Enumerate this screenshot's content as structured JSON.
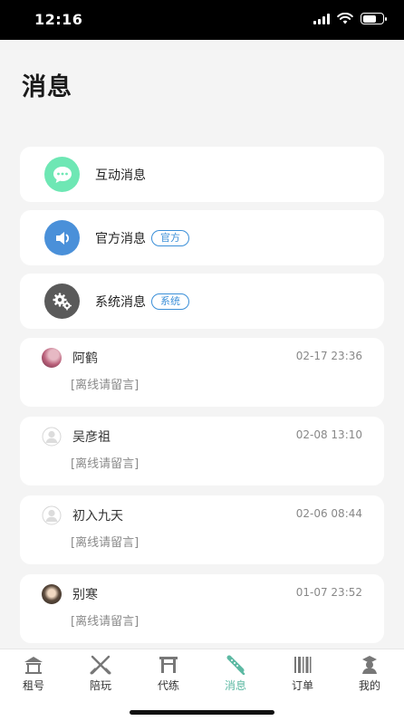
{
  "status": {
    "time": "12:16"
  },
  "page": {
    "title": "消息"
  },
  "categories": [
    {
      "label": "互动消息",
      "tag": "",
      "icon": "chat-bubble-icon",
      "color": "#6ee7b4"
    },
    {
      "label": "官方消息",
      "tag": "官方",
      "icon": "speaker-icon",
      "color": "#4a90d9"
    },
    {
      "label": "系统消息",
      "tag": "系统",
      "icon": "gear-icon",
      "color": "#5a5a5a"
    }
  ],
  "chats": [
    {
      "name": "阿鹤",
      "time": "02-17 23:36",
      "message": "[离线请留言]",
      "avatar": "photo"
    },
    {
      "name": "吴彦祖",
      "time": "02-08 13:10",
      "message": "[离线请留言]",
      "avatar": "default"
    },
    {
      "name": "初入九天",
      "time": "02-06 08:44",
      "message": "[离线请留言]",
      "avatar": "default"
    },
    {
      "name": "别寒",
      "time": "01-07 23:52",
      "message": "[离线请留言]",
      "avatar": "photo"
    }
  ],
  "tabs": [
    {
      "label": "租号",
      "icon": "pavilion-icon",
      "active": false
    },
    {
      "label": "陪玩",
      "icon": "crossed-swords-icon",
      "active": false
    },
    {
      "label": "代练",
      "icon": "gate-icon",
      "active": false
    },
    {
      "label": "消息",
      "icon": "message-icon",
      "active": true
    },
    {
      "label": "订单",
      "icon": "barcode-icon",
      "active": false
    },
    {
      "label": "我的",
      "icon": "profile-icon",
      "active": false
    }
  ],
  "colors": {
    "accent": "#5db9a3",
    "tag": "#3b8fd8"
  }
}
